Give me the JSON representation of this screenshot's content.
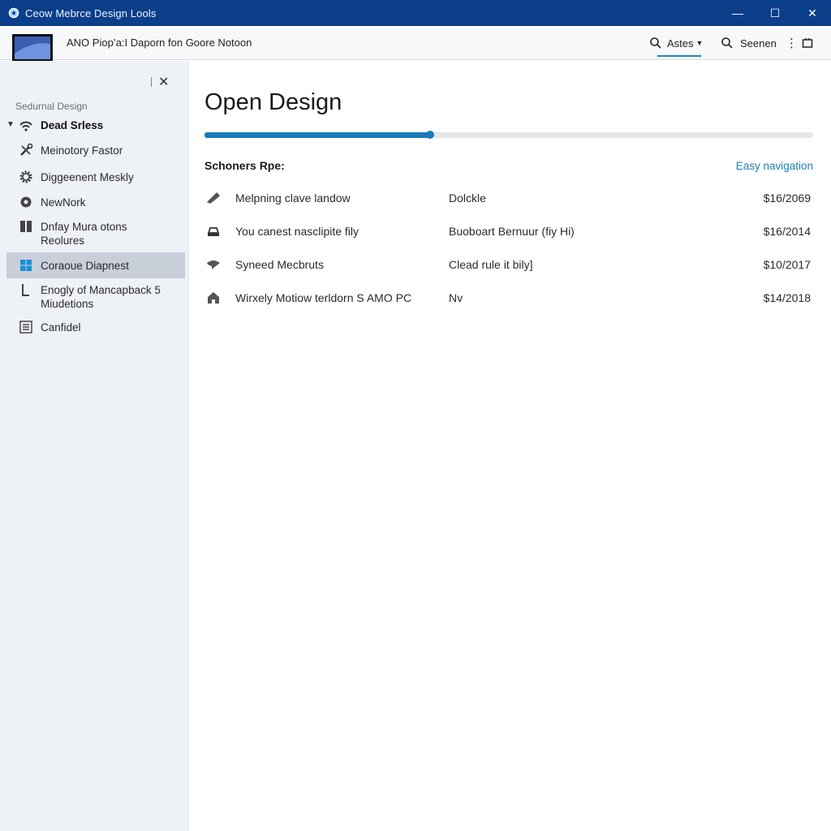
{
  "window": {
    "title": "Ceow Mebrce Design Lools",
    "controls": [
      "—",
      "☐",
      "✕"
    ]
  },
  "header": {
    "doc_title": "ANO Piop’a:I Daporn fon Goore Notoon",
    "astes_label": "Astes",
    "search_label": "Seenen",
    "more_glyph": "⋮"
  },
  "sidebar": {
    "close_glyph": "✕",
    "section_label": "Sedurnal Design",
    "items": [
      {
        "label": "Dead Srless",
        "icon": "wifi-icon"
      },
      {
        "label": "Meinotory Fastor",
        "icon": "tools-icon"
      },
      {
        "label": "Diggeenent Meskly",
        "icon": "gear-icon"
      },
      {
        "label": "NewNork",
        "icon": "network-gear-icon"
      },
      {
        "label": "Dnfay Mura otons Reolures",
        "icon": "grid-icon"
      },
      {
        "label": "Coraoue Diapnest",
        "icon": "windows-icon"
      },
      {
        "label": "Enogly of Mancapback 5 Miudetions",
        "icon": "bracket-icon"
      },
      {
        "label": "Canfidel",
        "icon": "list-icon"
      }
    ]
  },
  "main": {
    "heading": "Open Design",
    "progress": 0.37,
    "sub_heading": "Schoners Rpe:",
    "easy_nav": "Easy navigation",
    "rows": [
      {
        "icon": "wrench-icon",
        "name": "Melpning clave landow",
        "type": "Dolckle",
        "date": "$16/2069"
      },
      {
        "icon": "drive-icon",
        "name": "You canest nasclipite fily",
        "type": "Buoboart Bernuur (fiy Hi)",
        "date": "$16/2014"
      },
      {
        "icon": "chat-icon",
        "name": "Syneed Mecbruts",
        "type": "Clead rule it bily]",
        "date": "$10/2017"
      },
      {
        "icon": "home-icon",
        "name": "Wirxely Motiow terldorn S AMO PC",
        "type": "Nv",
        "date": "$14/2018"
      }
    ]
  },
  "colors": {
    "titlebar": "#0b3f8a",
    "accent": "#1a7bb8",
    "sidebar_bg": "#eef1f6",
    "selected_bg": "#c9cfd9",
    "link": "#1d7fb5"
  }
}
